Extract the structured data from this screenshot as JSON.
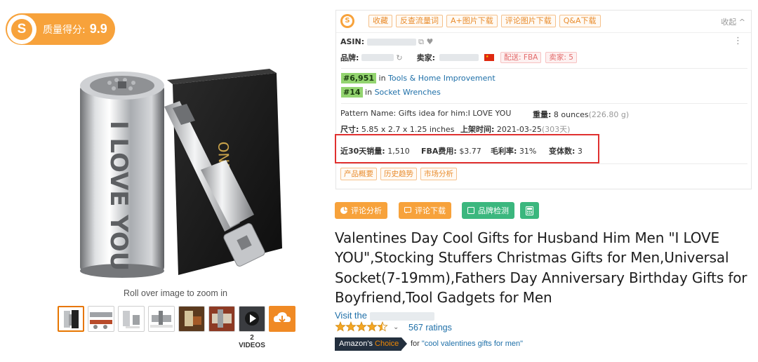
{
  "badge": {
    "label": "质量得分:",
    "score": "9.9",
    "logo_letter": "S"
  },
  "image": {
    "zoom_hint": "Roll over image to zoom in",
    "videos_label": "2 VIDEOS",
    "product_text": "I LOVE YOU",
    "box_brand": "ONEAGE"
  },
  "toolbar": {
    "buttons": [
      "收藏",
      "反查流量词",
      "A+图片下载",
      "评论图片下载",
      "Q&A下载"
    ],
    "collapse": "收起 ^"
  },
  "panel": {
    "asin_label": "ASIN:",
    "brand_label": "品牌:",
    "seller_label": "卖家:",
    "fulfillment": "配送: FBA",
    "seller_count": "卖家: 5",
    "rank1": {
      "rank": "#6,951",
      "in": "in",
      "category": "Tools & Home Improvement"
    },
    "rank2": {
      "rank": "#14",
      "in": "in",
      "category": "Socket Wrenches"
    },
    "pattern_label": "Pattern Name:",
    "pattern_value": "Gifts idea for him:I LOVE YOU",
    "weight_label": "重量:",
    "weight_value": "8 ounces",
    "weight_grams": "(226.80 g)",
    "size_label": "尺寸:",
    "size_value": "5.85 x 2.7 x 1.25 inches",
    "listed_label": "上架时间:",
    "listed_value": "2021-03-25",
    "listed_days": "(303天)",
    "sales_label": "近30天销量:",
    "sales_value": "1,510",
    "fba_label": "FBA费用:",
    "fba_value": "$3.77",
    "margin_label": "毛利率:",
    "margin_value": "31%",
    "variants_label": "变体数:",
    "variants_value": "3",
    "tabs": [
      "产品概要",
      "历史趋势",
      "市场分析"
    ]
  },
  "actions": {
    "review_analysis": "评论分析",
    "review_download": "评论下载",
    "brand_check": "品牌检测"
  },
  "colors": {
    "orange": "#f7a23b",
    "amazon_orange": "#f08804",
    "link": "#1e6fa8",
    "green_action": "#3bb77e",
    "highlight_box": "#e0302f"
  },
  "product": {
    "title": "Valentines Day Cool Gifts for Husband Him Men \"I LOVE YOU\",Stocking Stuffers Christmas Gifts for Men,Universal Socket(7-19mm),Fathers Day Anniversary Birthday Gifts for Boyfriend,Tool Gadgets for Men",
    "visit_prefix": "Visit the",
    "rating_stars": 4.5,
    "ratings": "567 ratings",
    "choice_prefix": "Amazon's",
    "choice_word": "Choice",
    "for_prefix": "for",
    "for_query": "\"cool valentines gifts for men\""
  }
}
